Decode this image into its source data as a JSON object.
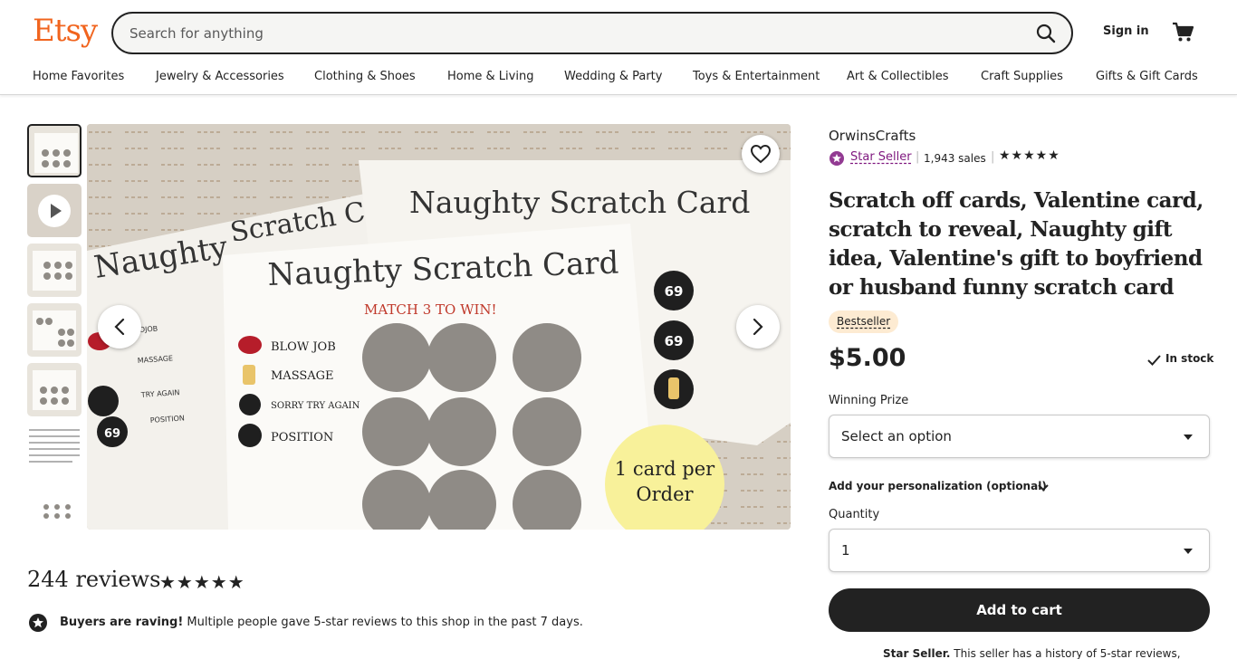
{
  "header": {
    "logo": "Etsy",
    "search_placeholder": "Search for anything",
    "sign_in": "Sign in"
  },
  "nav": [
    "Home Favorites",
    "Jewelry & Accessories",
    "Clothing & Shoes",
    "Home & Living",
    "Wedding & Party",
    "Toys & Entertainment",
    "Art & Collectibles",
    "Craft Supplies",
    "Gifts & Gift Cards"
  ],
  "image": {
    "back_card_left": "Naughty",
    "back_card_mid": "Scratch C",
    "back_card_right": "Naughty Scratch Card",
    "front_card_title": "Naughty Scratch Card",
    "match_text": "MATCH 3 TO WIN!",
    "prizes": [
      "BLOW JOB",
      "MASSAGE",
      "SORRY TRY AGAIN",
      "POSITION"
    ],
    "left_items": [
      "MASSAGE",
      "TRY AGAIN",
      "POSITION",
      "69",
      "OJOB"
    ],
    "right_numbers": [
      "69",
      "69"
    ],
    "circle_line1": "1 card per",
    "circle_line2": "Order"
  },
  "reviews": {
    "count": "244 reviews",
    "stars": "★★★★★",
    "raving_bold": "Buyers are raving!",
    "raving_text": " Multiple people gave 5-star reviews to this shop in the past 7 days."
  },
  "shop": {
    "name": "OrwinsCrafts",
    "star_seller": "Star Seller",
    "sales": "1,943 sales",
    "stars": "★★★★★"
  },
  "listing": {
    "title": "Scratch off cards, Valentine card, scratch to reveal, Naughty gift idea, Valentine's gift to boyfriend or husband funny scratch card",
    "badge": "Bestseller",
    "price": "$5.00",
    "stock": "In stock",
    "winning_prize_label": "Winning Prize",
    "winning_prize_value": "Select an option",
    "personalization": "Add your personalization (optional)",
    "quantity_label": "Quantity",
    "quantity_value": "1",
    "add_to_cart": "Add to cart",
    "star_seller_note_bold": "Star Seller.",
    "star_seller_note": " This seller has a history of 5-star reviews,"
  },
  "colors": {
    "brand": "#f1641e",
    "star_seller": "#7f187f",
    "badge_bg": "#fdebd2",
    "button": "#222222"
  }
}
